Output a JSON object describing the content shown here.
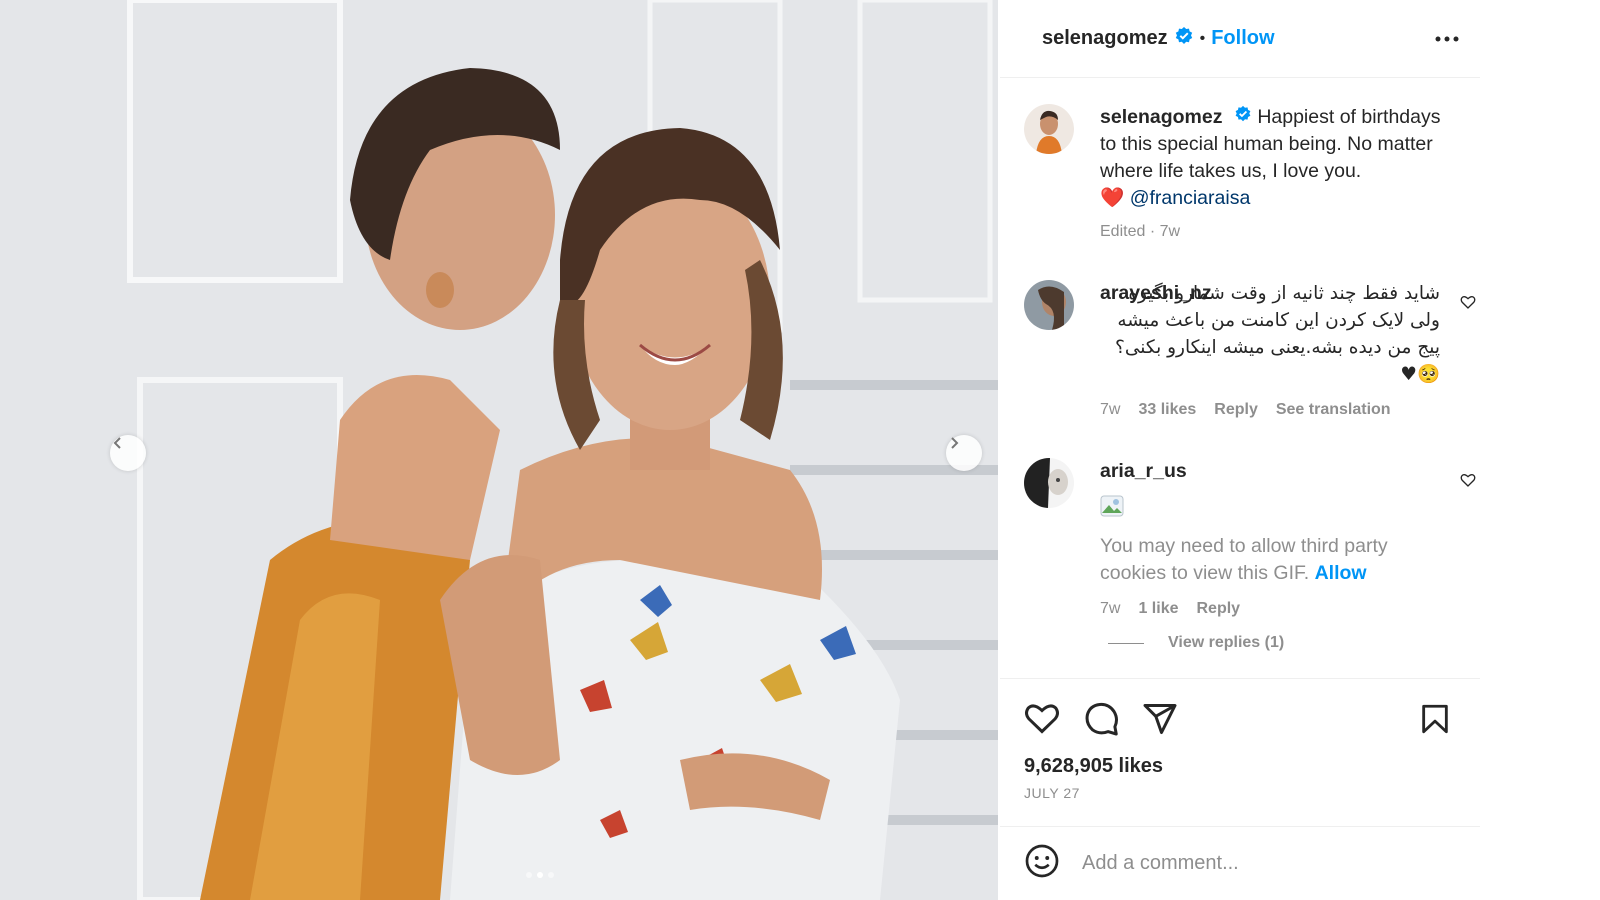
{
  "post": {
    "author": "selenagomez",
    "follow_label": "Follow",
    "separator": "•"
  },
  "caption": {
    "username": "selenagomez",
    "text": "Happiest of birthdays to this special human being. No matter where life takes us, I love you.",
    "heart": "❤️",
    "mention": "@franciaraisa",
    "meta": "Edited · 7w"
  },
  "comments": [
    {
      "username": "arayeshi_nz",
      "text": "شاید فقط چند ثانیه از وقت شمارو بگیره ولی لایک کردن این کامنت من باعث میشه پیج من دیده بشه.یعنی میشه اینکارو بکنی؟🥺♥",
      "time": "7w",
      "likes": "33 likes",
      "reply": "Reply",
      "translate": "See translation"
    },
    {
      "username": "aria_r_us",
      "gif_note": "You may need to allow third party cookies to view this GIF.",
      "allow": "Allow",
      "time": "7w",
      "likes": "1 like",
      "reply": "Reply"
    }
  ],
  "view_replies": "View replies (1)",
  "likes_count": "9,628,905 likes",
  "date": "JULY 27",
  "comment_input": {
    "placeholder": "Add a comment..."
  },
  "colors": {
    "link": "#0095f6",
    "text": "#262626",
    "muted": "#8e8e8e",
    "verified": "#0095f6",
    "heart_red": "#ed4956"
  },
  "icons": [
    "chevron-left-icon",
    "chevron-right-icon",
    "verified-badge-icon",
    "more-options-icon",
    "heart-icon",
    "comment-icon",
    "share-icon",
    "bookmark-icon",
    "emoji-icon"
  ],
  "carousel": {
    "slides": 3,
    "active_index": 1
  }
}
